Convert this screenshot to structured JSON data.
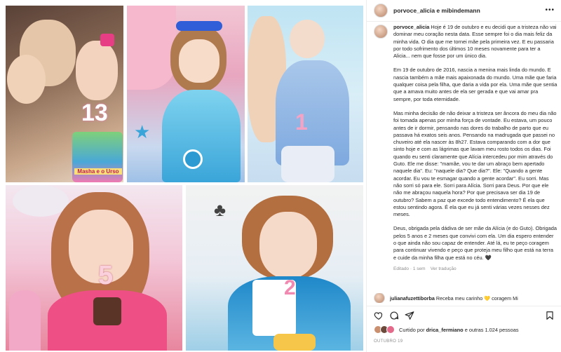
{
  "colors": {
    "accent": "#262626",
    "muted": "#8e8e8e",
    "border": "#ededed"
  },
  "photo_collage": {
    "tile1": {
      "cake_number": "13",
      "cake_banner": "Masha e o Urso"
    },
    "tile3": {
      "cake_number": "1"
    },
    "tile4": {
      "candle_number": "5"
    },
    "tile5": {
      "candle_number": "2"
    }
  },
  "header": {
    "username": "porvoce_alicia e mibindemann",
    "more_icon": "more-horizontal-icon"
  },
  "caption": {
    "username": "porvoce_alicia",
    "paragraphs": [
      "Hoje é 19 de outubro e eu decidi que a tristeza não vai dominar meu coração nesta data. Esse sempre foi o dia mais feliz da minha vida. O dia que me tornei mãe pela primeira vez. E eu passaria por todo sofrimento dos últimos 10 meses novamente para ter a Alicia... nem que fosse por um único dia.",
      "Em 19 de outubro de 2016, nascia a menina mais linda do mundo. E nascia também a mãe mais apaixonada do mundo. Uma mãe que faria qualquer coisa pela filha, que daria a vida por ela. Uma mãe que sentia que a amava muito antes de ela ser gerada e que vai amar pra sempre, por toda eternidade.",
      "Mas minha decisão de não deixar a tristeza ser âncora do meu dia não foi tomada apenas por minha força de vontade. Eu estava, um pouco antes de ir dormir, pensando nas dores do trabalho de parto que eu passava há exatos seis anos. Pensando na madrugada que passei no chuveiro até ela nascer às 8h27. Estava comparando com a dor que sinto hoje e com as lágrimas que lavam meu rosto todos os dias. Foi quando eu senti claramente que Alícia intercedeu por mim através do Guto. Ele me disse: \"mamãe, vou te dar um abraço bem apertado naquele dia\". Eu: \"naquele dia? Que dia?\". Ele: \"Quando a gente acordar. Eu vou te esmagar quando a gente acordar\". Eu sorri. Mas não sorri só para ele. Sorri para Alícia. Sorri para Deus. Por que ele não me abraçou naquela hora? Por que precisava ser dia 19 de outubro? Sabem a paz que excede todo entendimento? É ela que estou sentindo agora. É ela que eu já senti várias vezes nesses dez meses.",
      "Deus, obrigada pela dádiva de ser mãe da Alícia (e do Guto). Obrigada pelos 5 anos e 2 meses que convivi com ela. Um dia espero entender o que ainda não sou capaz de entender. Até lá, eu te peço coragem para continuar vivendo e peço que proteja meu filho que está na terra e cuide da minha filha que está no céu. 🖤"
    ],
    "edited": "Editado · 1 sem",
    "see_translation": "Ver tradução"
  },
  "comment": {
    "username": "julianafuzettiborba",
    "text": "Receba meu carinho 💛 coragem Mi"
  },
  "actions": {
    "like_icon": "heart-icon",
    "comment_icon": "comment-icon",
    "share_icon": "send-icon",
    "save_icon": "bookmark-icon"
  },
  "likes": {
    "prefix": "Curtido por",
    "user": "drica_fermiano",
    "suffix": "e outras 1.024 pessoas"
  },
  "date": "OUTUBRO 19"
}
